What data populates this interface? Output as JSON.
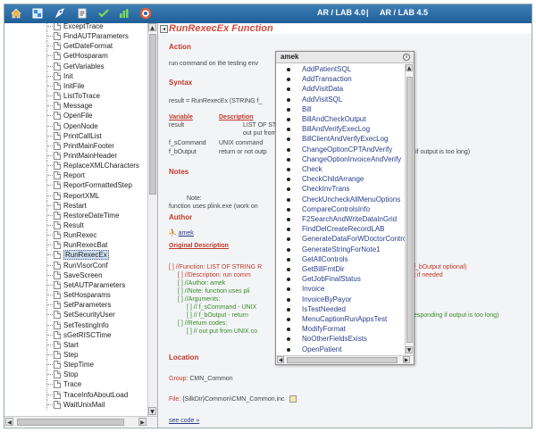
{
  "topbar": {
    "version_left": "AR / LAB  4.0",
    "separator": "|",
    "version_right": "AR / LAB  4.5",
    "icons": [
      "home-icon",
      "grid-icon",
      "rocket-icon",
      "document-icon",
      "check-icon",
      "bar-chart-icon",
      "lifebuoy-icon"
    ]
  },
  "sidebar": {
    "items": [
      {
        "label": "ExceptTrace"
      },
      {
        "label": "FindAUTParameters"
      },
      {
        "label": "GetDateFormat"
      },
      {
        "label": "GetHosparam"
      },
      {
        "label": "GetVariables"
      },
      {
        "label": "Init"
      },
      {
        "label": "InitFile"
      },
      {
        "label": "ListToTrace"
      },
      {
        "label": "Message"
      },
      {
        "label": "OpenFile"
      },
      {
        "label": "OpenNode"
      },
      {
        "label": "PrintCallList"
      },
      {
        "label": "PrintMainFooter"
      },
      {
        "label": "PrintMainHeader"
      },
      {
        "label": "ReplaceXMLCharacters"
      },
      {
        "label": "Report"
      },
      {
        "label": "ReportFormattedStep"
      },
      {
        "label": "ReportXML"
      },
      {
        "label": "Restart"
      },
      {
        "label": "RestoreDateTime"
      },
      {
        "label": "Result"
      },
      {
        "label": "RunRexec"
      },
      {
        "label": "RunRexecBat"
      },
      {
        "label": "RunRexecEx",
        "selected": true
      },
      {
        "label": "RunVisorConf"
      },
      {
        "label": "SaveScreen"
      },
      {
        "label": "SetAUTParameters"
      },
      {
        "label": "SetHosparams"
      },
      {
        "label": "SetParameters"
      },
      {
        "label": "SetSecurityUser"
      },
      {
        "label": "SetTestingInfo"
      },
      {
        "label": "sGetRISCTime"
      },
      {
        "label": "Start"
      },
      {
        "label": "Step"
      },
      {
        "label": "StepTime"
      },
      {
        "label": "Stop"
      },
      {
        "label": "Trace"
      },
      {
        "label": "TraceInfoAboutLoad"
      },
      {
        "label": "WaitUnixMail"
      }
    ]
  },
  "content": {
    "collapse_glyph": "◂",
    "title": "RunRexecEx Function",
    "action_h": "Action",
    "action_text": "run command on the testing env",
    "syntax_h": "Syntax",
    "syntax_text": "result = RunRexecEx (STRING f_",
    "col_variable": "Variable",
    "col_description": "Description",
    "rows": [
      {
        "var": "result",
        "desc": "LIST OF STRING:"
      },
      {
        "var": "",
        "desc": "out put from UNI"
      },
      {
        "var": "f_sCommand",
        "desc": "UNIX command"
      },
      {
        "var": "f_bOutput",
        "desc": "return or not outp"
      }
    ],
    "right_fragment_1": "if output is too long)",
    "notes_h": "Notes",
    "note_label": "Note:",
    "note_text": "function uses plink.exe (work on",
    "author_h": "Author",
    "author_name": "amek",
    "original_h": "Original Description",
    "orig_lines": [
      "[ ] //Function: LIST OF STRING R",
      "[ ] //Description: run comm",
      "[ ] //Author: amek",
      "[ ] //Note: function uses pli",
      "[ ] //Arguments:",
      "[ ] //   f_sCommand - UNIX",
      "[ ] //   f_bOutput  - return",
      "[ ] //Return codes:",
      "[ ] //   out put from UNIX co"
    ],
    "orig_right_1": "f_bOutput optional)",
    "orig_right_2": "t if needed",
    "orig_right_3": "esponding if output is too long)",
    "location_h": "Location",
    "group_label": "Group:",
    "group_value": "CMN_Common",
    "file_label": "File:",
    "file_value": "{SilkDir}Common\\CMN_Common.inc",
    "see_code": "see code »"
  },
  "popup": {
    "title": "amek",
    "close_glyph": "x",
    "items": [
      "AddPatientSQL",
      "AddTransaction",
      "AddVisitData",
      "AddVisitSQL",
      "Bill",
      "BillAndCheckOutput",
      "BillAndVerifyExecLog",
      "BillClientAndVerifyExecLog",
      "ChangeOptionCPTAndVerify",
      "ChangeOptionInvoiceAndVerify",
      "Check",
      "CheckChildArrange",
      "CheckInvTrans",
      "CheckUncheckAllMenuOptions",
      "CompareControlsInfo",
      "F2SearchAndWriteDataInGrid",
      "FindDelCreateRecordLAB",
      "GenerateDataForWDoctorControls",
      "GenerateStringForNote1",
      "GetAllControls",
      "GetBillFmtDir",
      "GetJobFinalStatus",
      "Invoice",
      "InvoiceByPayor",
      "IsTestNeeded",
      "MenuCaptionRunAppsTest",
      "ModifyFormat",
      "NoOtherFieldsExists",
      "OpenPatient"
    ]
  },
  "colors": {
    "topbar": "#2a6aa6",
    "title_red": "#d24a3c",
    "link_blue": "#2a3f8a",
    "code_green": "#3a8a2a",
    "selected_bg": "#cfe0f4"
  }
}
